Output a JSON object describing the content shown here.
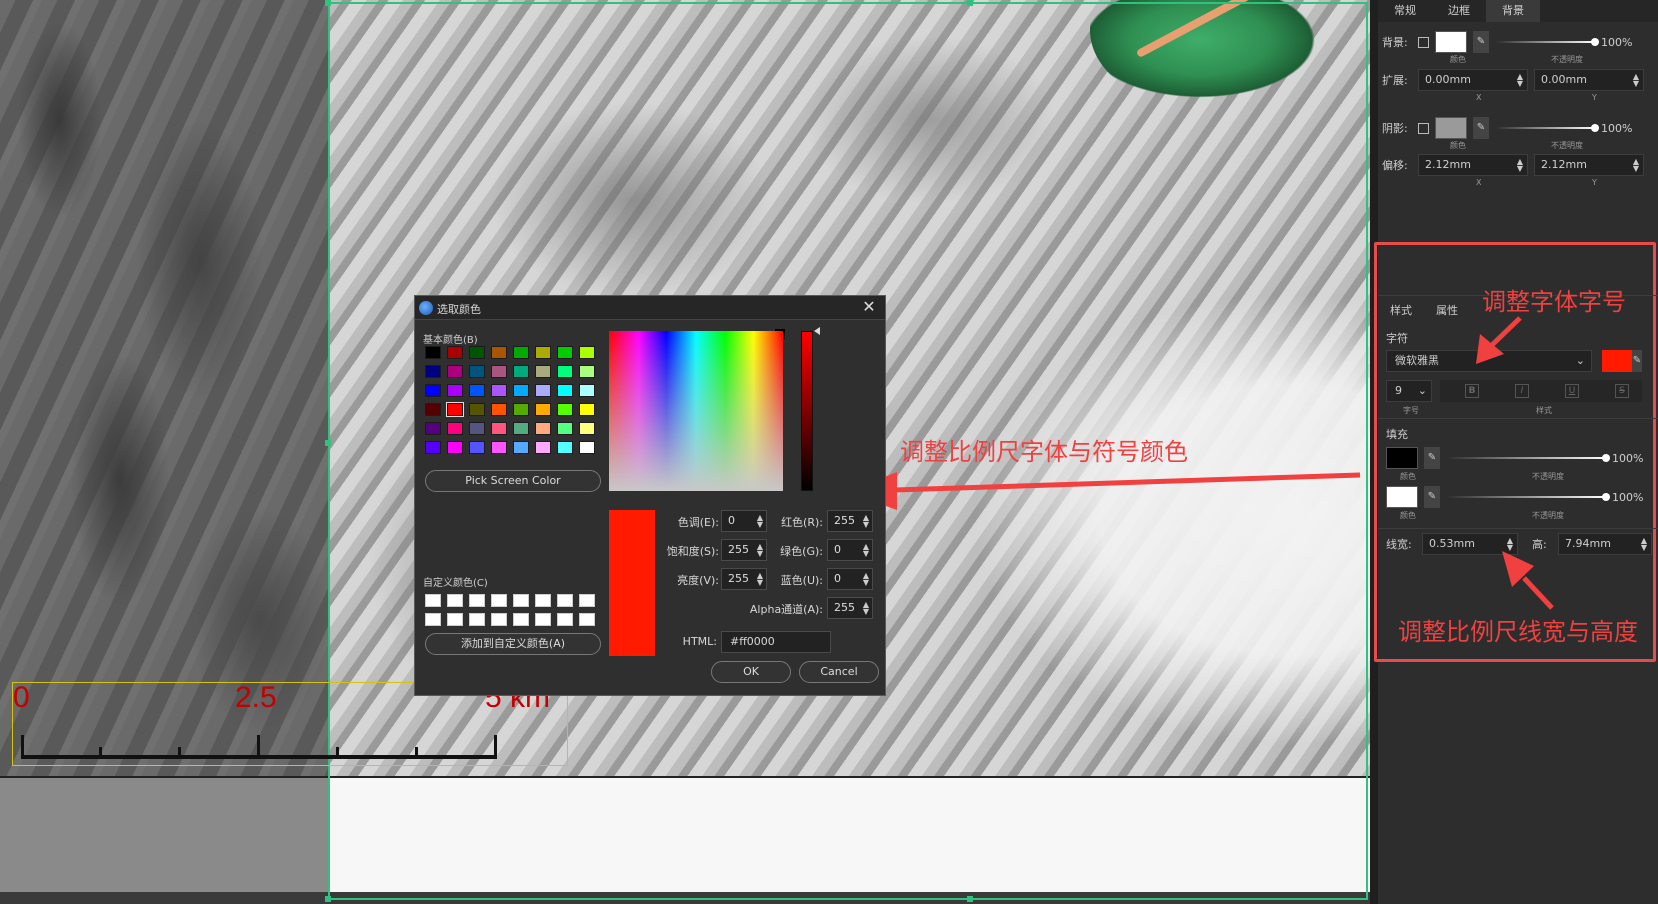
{
  "scale_bar": {
    "labels": [
      "0",
      "2.5",
      "5 km"
    ],
    "label_color": "#c40000",
    "border_color": "#d4c21a"
  },
  "right_panel": {
    "top_tabs": [
      "常规",
      "边框",
      "背景"
    ],
    "top_active_tab": "背景",
    "background": {
      "label": "背景:",
      "swatch_color": "#ffffff",
      "swatch_caption": "颜色",
      "opacity": "100%",
      "opacity_caption": "不透明度"
    },
    "expand": {
      "label": "扩展:",
      "x": "0.00mm",
      "y": "0.00mm",
      "x_caption": "X",
      "y_caption": "Y"
    },
    "shadow": {
      "label": "阴影:",
      "swatch_color": "#9a9a9a",
      "swatch_caption": "颜色",
      "opacity": "100%",
      "opacity_caption": "不透明度"
    },
    "offset": {
      "label": "偏移:",
      "x": "2.12mm",
      "y": "2.12mm",
      "x_caption": "X",
      "y_caption": "Y"
    },
    "lower_tabs": [
      "样式",
      "属性"
    ],
    "lower_active_tab": "样式",
    "font_section": "字符",
    "font_family": "微软雅黑",
    "font_color": "#ff1a00",
    "font_size": "9",
    "font_size_caption": "字号",
    "style_caption": "样式",
    "style_buttons": [
      "B",
      "I",
      "U",
      "S"
    ],
    "fill_section": "填充",
    "fill_1": {
      "color": "#000000",
      "caption": "颜色",
      "opacity": "100%",
      "opacity_caption": "不透明度"
    },
    "fill_2": {
      "color": "#ffffff",
      "caption": "颜色",
      "opacity": "100%",
      "opacity_caption": "不透明度"
    },
    "line_width_label": "线宽:",
    "line_width": "0.53mm",
    "height_label": "高:",
    "height": "7.94mm"
  },
  "annotations": {
    "font_size_note": "调整字体字号",
    "scale_color_note": "调整比例尺字体与符号颜色",
    "line_width_note": "调整比例尺线宽与高度",
    "color": "#f04040"
  },
  "dialog": {
    "title": "选取颜色",
    "basic_colors_label": "基本颜色(B)",
    "basic_colors": [
      "#000000",
      "#aa0000",
      "#005500",
      "#aa5500",
      "#00aa00",
      "#aaaa00",
      "#00cc00",
      "#aaff00",
      "#00007f",
      "#aa007f",
      "#00557f",
      "#aa557f",
      "#00aa7f",
      "#aaaa7f",
      "#00ff7f",
      "#aaff7f",
      "#0000ff",
      "#aa00ff",
      "#0055ff",
      "#aa55ff",
      "#00aaff",
      "#aaaaff",
      "#00ffff",
      "#aaffff",
      "#550000",
      "#ff0000",
      "#555500",
      "#ff5500",
      "#55aa00",
      "#ffaa00",
      "#55ff00",
      "#ffff00",
      "#55007f",
      "#ff007f",
      "#55557f",
      "#ff557f",
      "#55aa7f",
      "#ffaa7f",
      "#55ff7f",
      "#ffff7f",
      "#5500ff",
      "#ff00ff",
      "#5555ff",
      "#ff55ff",
      "#55aaff",
      "#ffaaff",
      "#55ffff",
      "#ffffff"
    ],
    "pick_screen_label": "Pick Screen Color",
    "custom_colors_label": "自定义颜色(C)",
    "add_custom_label": "添加到自定义颜色(A)",
    "preview_color": "#ff1a00",
    "fields": {
      "hue": {
        "label": "色调(E):",
        "value": "0"
      },
      "saturation": {
        "label": "饱和度(S):",
        "value": "255"
      },
      "value": {
        "label": "亮度(V):",
        "value": "255"
      },
      "red": {
        "label": "红色(R):",
        "value": "255"
      },
      "green": {
        "label": "绿色(G):",
        "value": "0"
      },
      "blue": {
        "label": "蓝色(U):",
        "value": "0"
      },
      "alpha": {
        "label": "Alpha通道(A):",
        "value": "255"
      }
    },
    "html_label": "HTML:",
    "html_value": "#ff0000",
    "ok_label": "OK",
    "cancel_label": "Cancel"
  }
}
